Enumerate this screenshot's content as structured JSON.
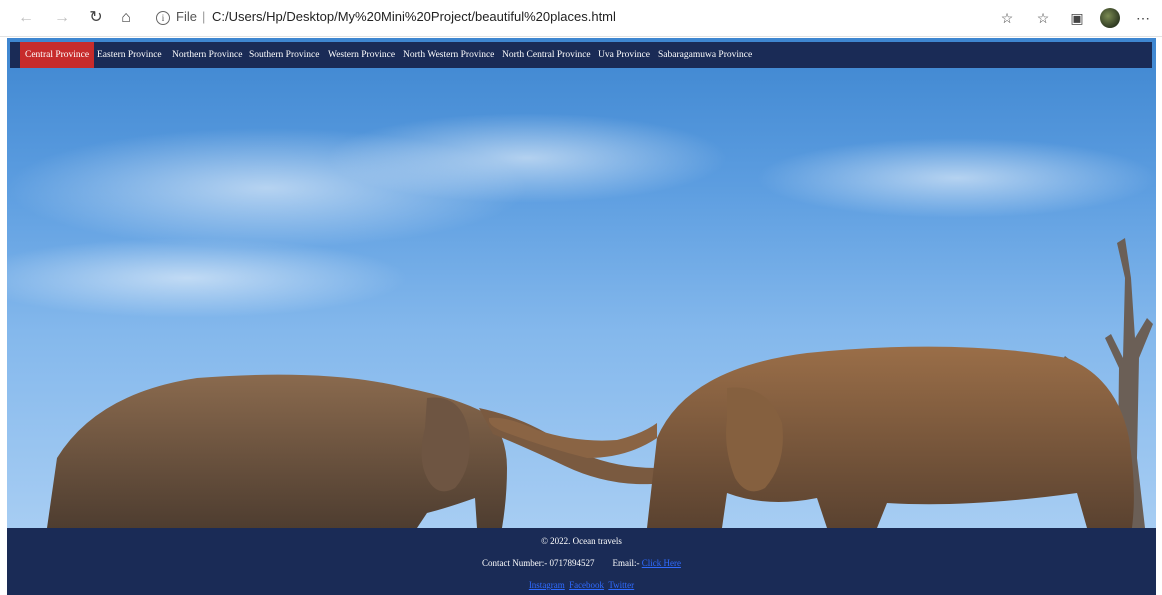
{
  "browser": {
    "address_prefix": "File",
    "address_sep": "|",
    "url": "C:/Users/Hp/Desktop/My%20Mini%20Project/beautiful%20places.html"
  },
  "menu": {
    "items": [
      "Central Province",
      "Eastern Province",
      "Northern Province",
      "Southern Province",
      "Western Province",
      "North Western Province",
      "North Central Province",
      "Uva Province",
      "Sabaragamuwa Province"
    ],
    "active_index": 0
  },
  "footer": {
    "copyright": "© 2022. Ocean travels",
    "contact_label": "Contact Number:- 0717894527",
    "email_label": "Email:-",
    "email_link": "Click Here",
    "social": [
      "Instagram",
      "Facebook",
      "Twitter"
    ]
  },
  "colors": {
    "nav_bg": "#1a2b56",
    "active_item": "#c72b2b",
    "footer_bg": "#1a2b56",
    "link": "#2f6bff"
  }
}
